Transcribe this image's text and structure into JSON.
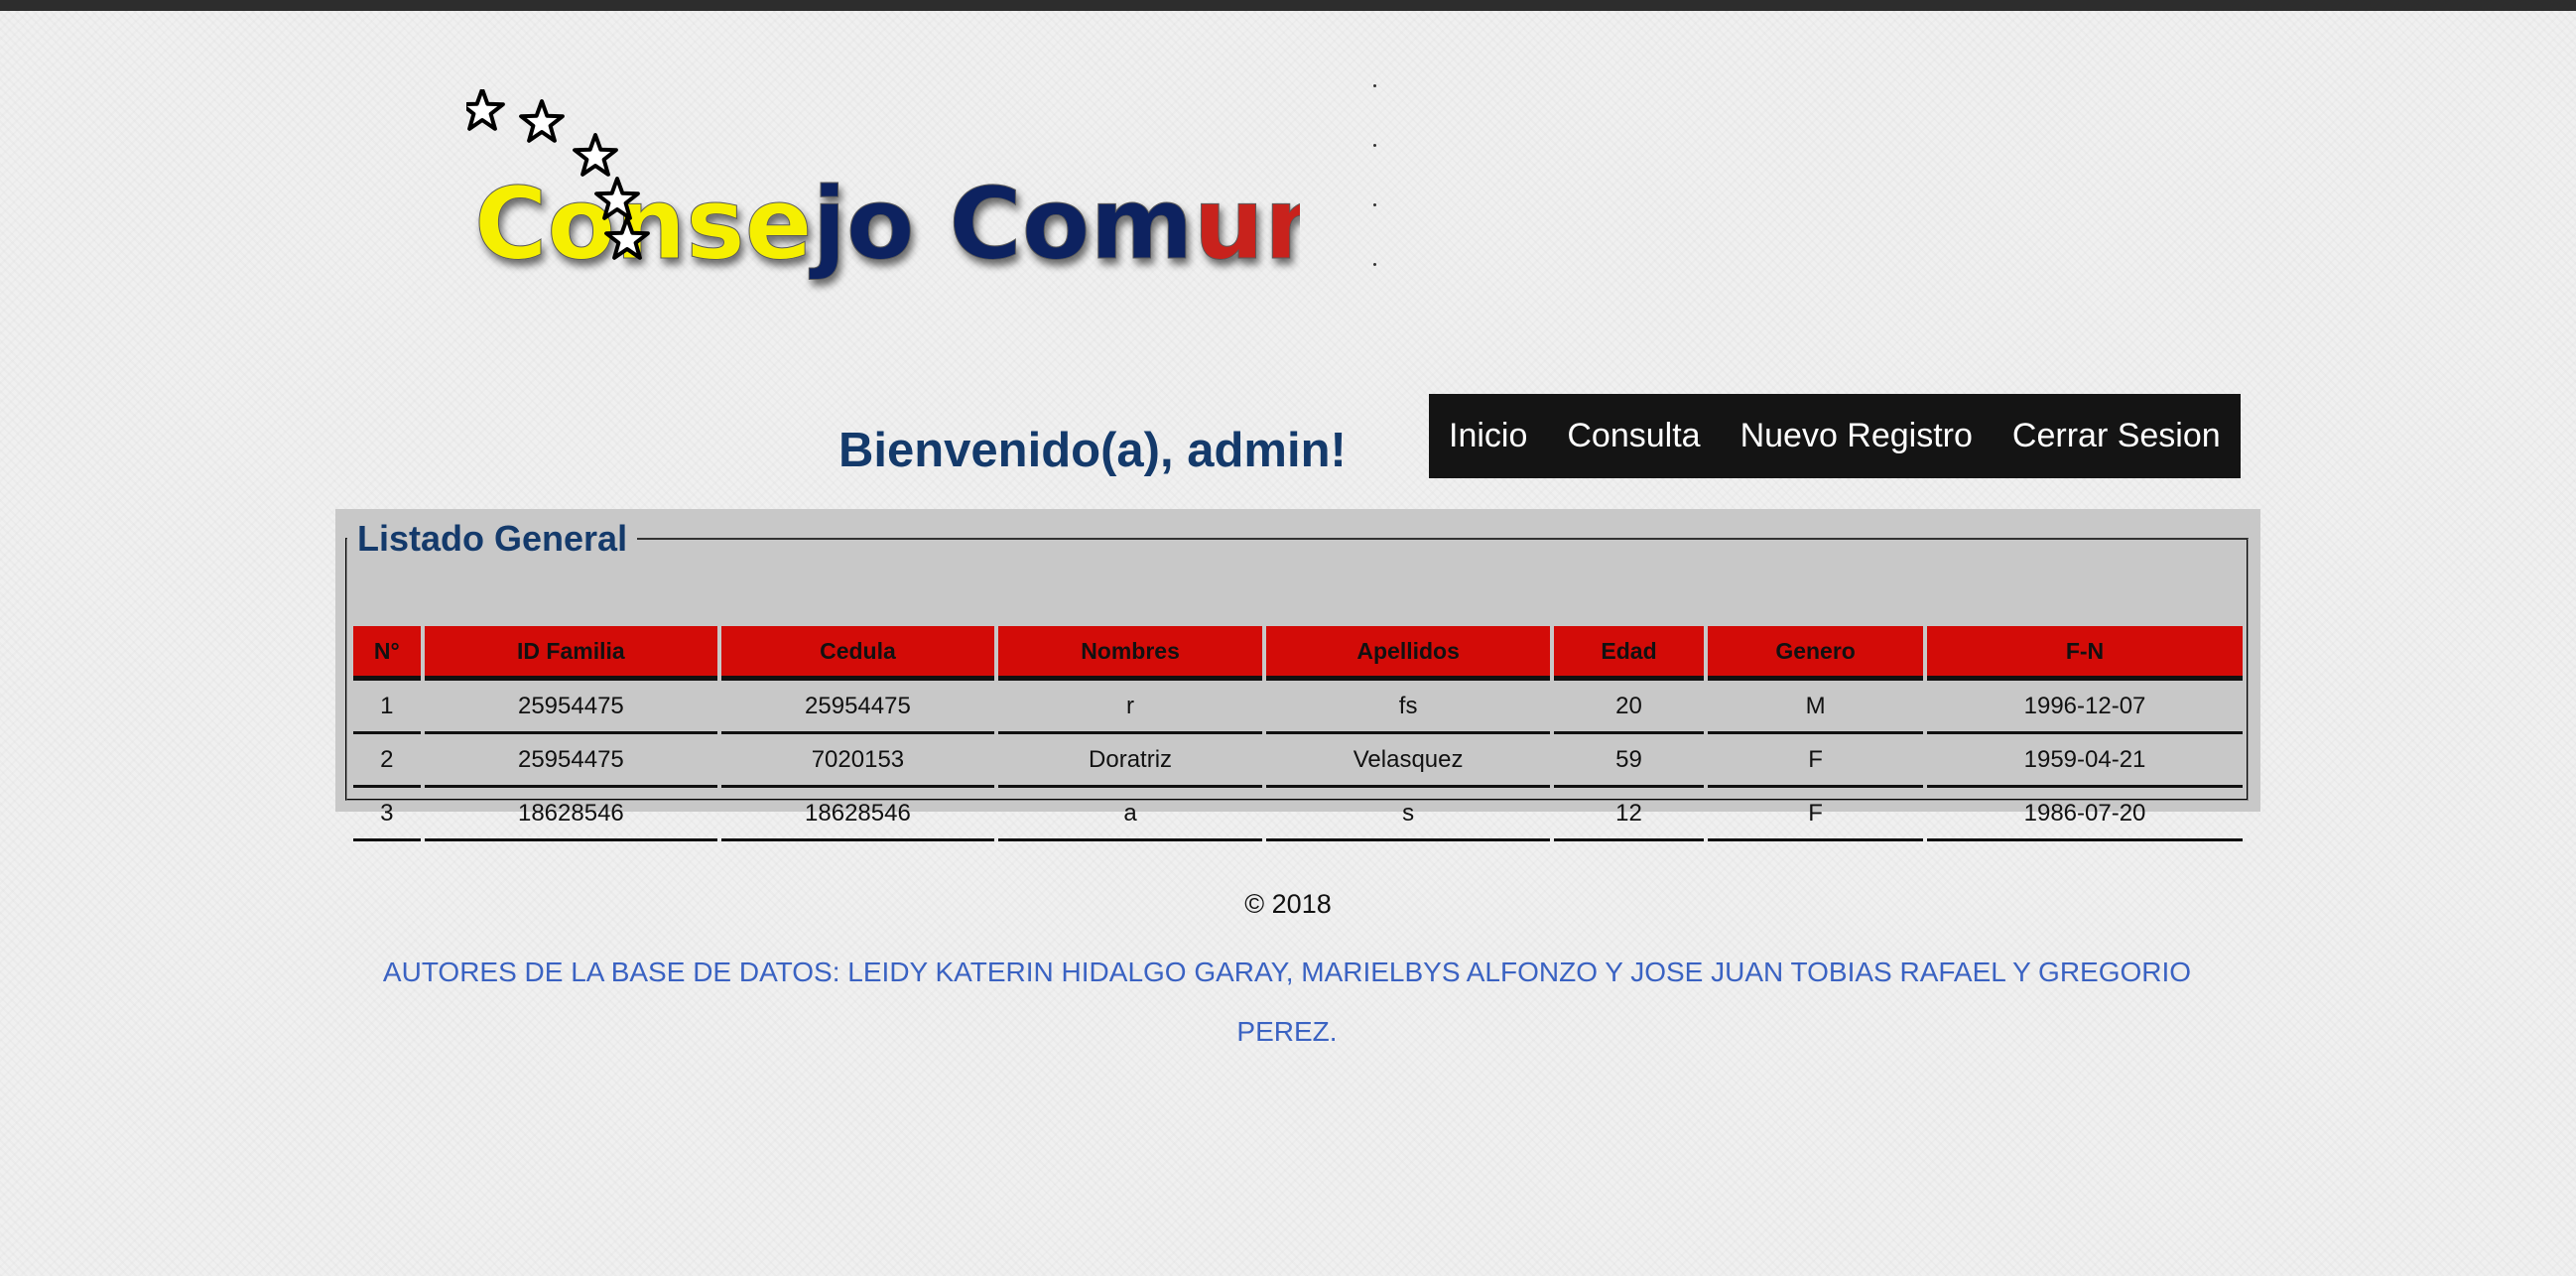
{
  "logo": {
    "word_parts": [
      "Conse",
      "jo Com",
      "unal"
    ],
    "colors": [
      "#f6f000",
      "#0e2460",
      "#c8211b"
    ]
  },
  "welcome": "Bienvenido(a), admin!",
  "nav": {
    "items": [
      "Inicio",
      "Consulta",
      "Nuevo Registro",
      "Cerrar Sesion"
    ]
  },
  "listado": {
    "legend": "Listado General",
    "headers": [
      "N°",
      "ID Familia",
      "Cedula",
      "Nombres",
      "Apellidos",
      "Edad",
      "Genero",
      "F-N"
    ],
    "rows": [
      [
        "1",
        "25954475",
        "25954475",
        "r",
        "fs",
        "20",
        "M",
        "1996-12-07"
      ],
      [
        "2",
        "25954475",
        "7020153",
        "Doratriz",
        "Velasquez",
        "59",
        "F",
        "1959-04-21"
      ],
      [
        "3",
        "18628546",
        "18628546",
        "a",
        "s",
        "12",
        "F",
        "1986-07-20"
      ]
    ]
  },
  "footer": {
    "copyright": "© 2018",
    "authors": "AUTORES DE LA BASE DE DATOS: LEIDY KATERIN HIDALGO GARAY, MARIELBYS ALFONZO Y JOSE JUAN TOBIAS RAFAEL Y GREGORIO PEREZ."
  },
  "colors": {
    "header_red": "#d30b07",
    "nav_bg": "#141414",
    "title_blue": "#143a6b",
    "link_blue": "#3a62c2"
  }
}
